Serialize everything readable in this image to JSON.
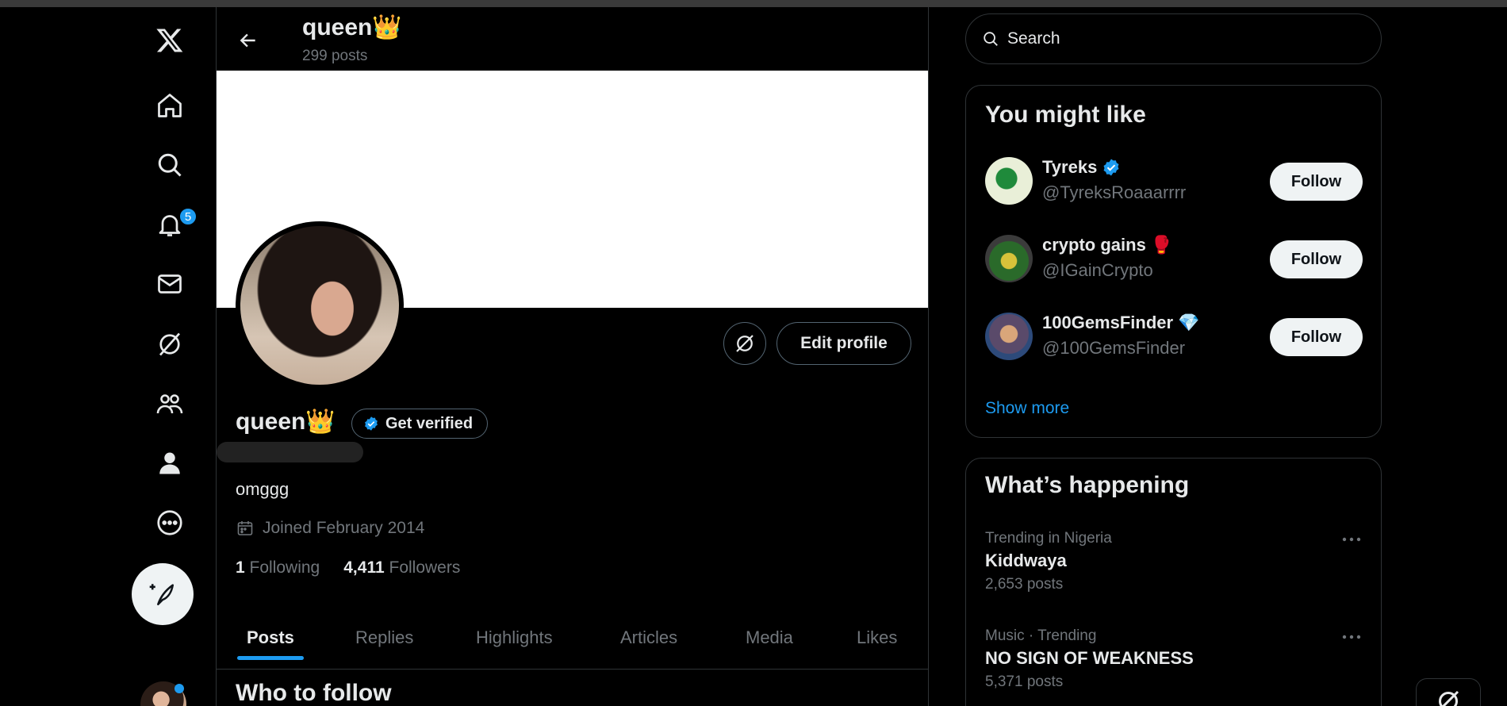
{
  "nav": {
    "notification_count": "5",
    "icons": [
      "x-logo-icon",
      "home-icon",
      "search-icon",
      "bell-icon",
      "mail-icon",
      "grok-icon",
      "communities-icon",
      "profile-icon",
      "more-icon",
      "compose-icon"
    ]
  },
  "header": {
    "name": "queen👑",
    "post_count": "299 posts"
  },
  "profile": {
    "name": "queen👑",
    "get_verified": "Get verified",
    "edit_profile": "Edit profile",
    "bio": "omggg",
    "joined": "Joined February 2014",
    "following_count": "1",
    "following_label": "Following",
    "followers_count": "4,411",
    "followers_label": "Followers"
  },
  "tabs": [
    {
      "label": "Posts",
      "active": true
    },
    {
      "label": "Replies"
    },
    {
      "label": "Highlights"
    },
    {
      "label": "Articles"
    },
    {
      "label": "Media"
    },
    {
      "label": "Likes"
    }
  ],
  "who_to_follow": "Who to follow",
  "search": {
    "placeholder": "Search"
  },
  "you_might_like": {
    "title": "You might like",
    "items": [
      {
        "name": "Tyreks",
        "emoji": "",
        "handle": "@TyreksRoaaarrrr",
        "verified": true,
        "follow": "Follow"
      },
      {
        "name": "crypto gains",
        "emoji": "🥊",
        "handle": "@IGainCrypto",
        "verified": false,
        "follow": "Follow"
      },
      {
        "name": "100GemsFinder",
        "emoji": "💎",
        "handle": "@100GemsFinder",
        "verified": false,
        "follow": "Follow"
      }
    ],
    "show_more": "Show more"
  },
  "whats_happening": {
    "title": "What’s happening",
    "trends": [
      {
        "meta": "Trending in Nigeria",
        "name": "Kiddwaya",
        "posts": "2,653 posts"
      },
      {
        "meta": "Music · Trending",
        "name": "NO SIGN OF WEAKNESS",
        "posts": "5,371 posts"
      }
    ]
  },
  "colors": {
    "accent": "#1d9bf0",
    "background": "#000000",
    "text": "#e7e9ea",
    "muted": "#71767b",
    "border": "#2f3336"
  }
}
